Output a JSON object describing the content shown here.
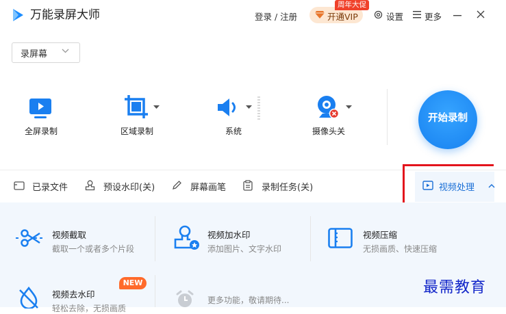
{
  "app": {
    "title": "万能录屏大师",
    "login": "登录 / 注册",
    "vip_label": "开通VIP",
    "promo_badge": "周年大促",
    "settings_label": "设置",
    "more_label": "更多"
  },
  "mode": {
    "selected": "录屏幕"
  },
  "record_options": [
    {
      "label": "全屏录制",
      "icon": "monitor-play-icon"
    },
    {
      "label": "区域录制",
      "icon": "crop-icon"
    },
    {
      "label": "系统",
      "icon": "speaker-icon"
    },
    {
      "label": "摄像头关",
      "icon": "webcam-off-icon"
    }
  ],
  "start_button": "开始录制",
  "toolbar": [
    {
      "label": "已录文件",
      "icon": "folder-icon"
    },
    {
      "label": "预设水印(关)",
      "icon": "stamp-icon"
    },
    {
      "label": "屏幕画笔",
      "icon": "pen-icon"
    },
    {
      "label": "录制任务(关)",
      "icon": "clipboard-icon"
    }
  ],
  "video_processing": {
    "label": "视频处理",
    "icon": "video-edit-icon"
  },
  "features": [
    {
      "title": "视频截取",
      "desc": "截取一个或者多个片段",
      "icon": "scissors-icon"
    },
    {
      "title": "视频加水印",
      "desc": "添加图片、文字水印",
      "icon": "watermark-stamp-icon"
    },
    {
      "title": "视频压缩",
      "desc": "无损画质、快速压缩",
      "icon": "compress-icon"
    },
    {
      "title": "视频去水印",
      "desc": "轻松去除，无损画质",
      "icon": "remove-watermark-icon",
      "badge": "NEW"
    },
    {
      "title": "",
      "desc": "更多功能，敬请期待...",
      "icon": "alarm-clock-icon"
    }
  ],
  "overlay_watermark": "最需教育",
  "colors": {
    "accent": "#1781f0",
    "highlight_border": "#e3141c",
    "vip_bg": "#fde7d2",
    "promo": "#f0412a",
    "new_badge": "#ff6a2b",
    "panel_bg": "#f2f7fd"
  }
}
